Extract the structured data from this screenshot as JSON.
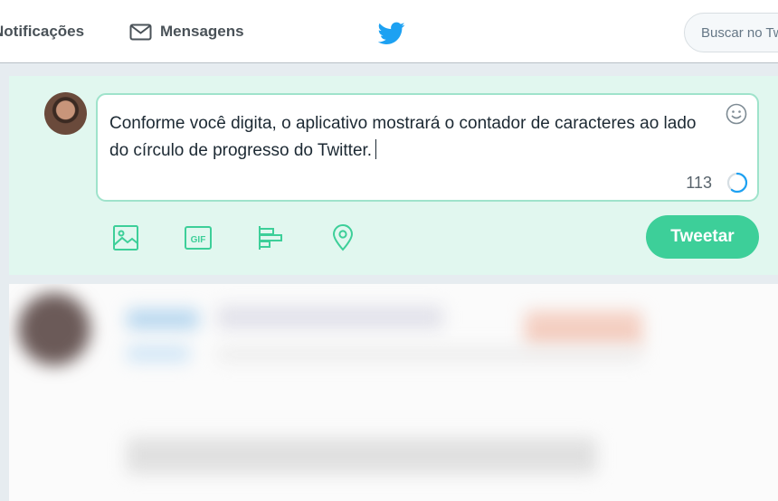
{
  "nav": {
    "notifications_label": "Notificações",
    "messages_label": "Mensagens",
    "search_placeholder": "Buscar no Twitter"
  },
  "composer": {
    "text": "Conforme você digita, o aplicativo mostrará o contador de caracteres ao lado do círculo de progresso do Twitter.",
    "remaining_count": "113",
    "progress_fraction": 0.6,
    "tweet_button_label": "Tweetar"
  },
  "colors": {
    "accent": "#3dcf99",
    "composer_bg": "#e1f7ef",
    "textbox_border": "#9fe3cb",
    "twitter_blue": "#1da1f2"
  },
  "icons": [
    "bell-icon",
    "mail-icon",
    "twitter-bird-icon",
    "emoji-icon",
    "image-icon",
    "gif-icon",
    "poll-icon",
    "location-icon"
  ]
}
